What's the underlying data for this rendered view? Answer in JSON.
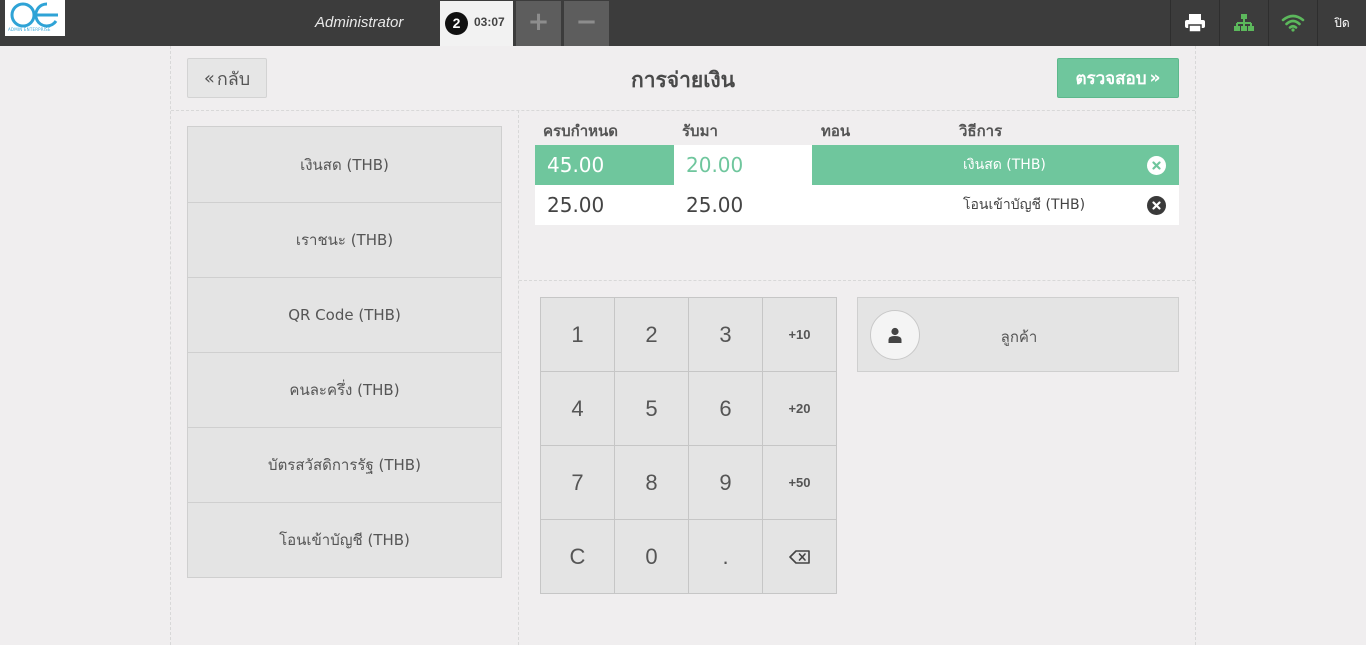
{
  "topbar": {
    "logo_text": "ADMIN ENTERPRISE",
    "user": "Administrator",
    "order_number": "2",
    "order_time": "03:07",
    "add_tab": "+",
    "remove_tab": "−",
    "icons": [
      "printer-icon",
      "sitemap-icon",
      "wifi-icon"
    ],
    "close_label": "ปิด"
  },
  "header": {
    "back_label": "กลับ",
    "title": "การจ่ายเงิน",
    "validate_label": "ตรวจสอบ"
  },
  "payment_methods": [
    "เงินสด (THB)",
    "เราชนะ (THB)",
    "QR Code (THB)",
    "คนละครึ่ง (THB)",
    "บัตรสวัสดิการรัฐ (THB)",
    "โอนเข้าบัญชี (THB)"
  ],
  "lines": {
    "columns": [
      "ครบกำหนด",
      "รับมา",
      "ทอน",
      "วิธีการ"
    ],
    "rows": [
      {
        "due": "45.00",
        "tendered": "20.00",
        "change": "",
        "method": "เงินสด (THB)",
        "selected": true
      },
      {
        "due": "25.00",
        "tendered": "25.00",
        "change": "",
        "method": "โอนเข้าบัญชี (THB)",
        "selected": false
      }
    ]
  },
  "numpad": {
    "keys": [
      "1",
      "2",
      "3",
      "+10",
      "4",
      "5",
      "6",
      "+20",
      "7",
      "8",
      "9",
      "+50",
      "C",
      "0",
      ".",
      "backspace-icon"
    ]
  },
  "customer": {
    "label": "ลูกค้า"
  },
  "colors": {
    "topbar": "#3c3c3c",
    "accent": "#6fc69d",
    "background": "#f0eeef",
    "wifi": "#5cb85c"
  }
}
